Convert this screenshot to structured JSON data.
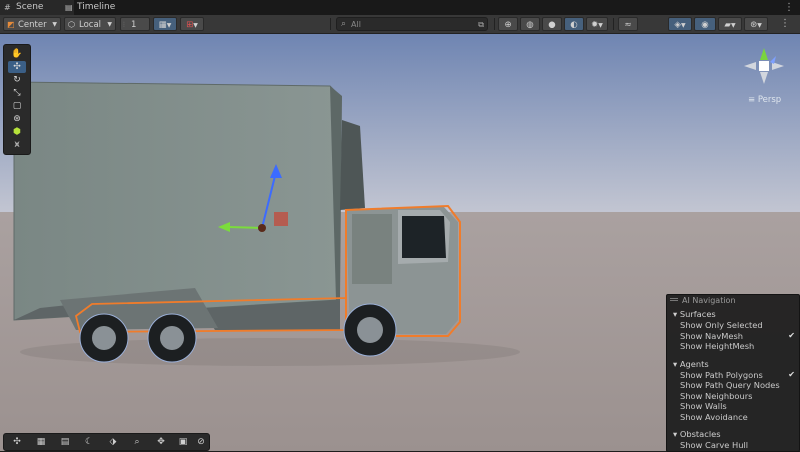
{
  "tabs": [
    {
      "label": "Scene",
      "icon": "hash-icon",
      "active": true
    },
    {
      "label": "Timeline",
      "icon": "timeline-icon",
      "active": false
    }
  ],
  "toolbar": {
    "pivot_label": "Center",
    "space_label": "Local",
    "snap_value": "1",
    "search_placeholder": "All",
    "accent_color": "#46607c"
  },
  "scene_view": {
    "projection_label": "Persp",
    "sky_top": "#7a8fb8",
    "ground_color": "#a59b98"
  },
  "ai_navigation": {
    "title": "AI Navigation",
    "sections": [
      {
        "label": "Surfaces",
        "items": [
          {
            "label": "Show Only Selected",
            "checked": false
          },
          {
            "label": "Show NavMesh",
            "checked": true
          },
          {
            "label": "Show HeightMesh",
            "checked": false
          }
        ]
      },
      {
        "label": "Agents",
        "items": [
          {
            "label": "Show Path Polygons",
            "checked": true
          },
          {
            "label": "Show Path Query Nodes",
            "checked": false
          },
          {
            "label": "Show Neighbours",
            "checked": false
          },
          {
            "label": "Show Walls",
            "checked": false
          },
          {
            "label": "Show Avoidance",
            "checked": false
          }
        ]
      },
      {
        "label": "Obstacles",
        "items": [
          {
            "label": "Show Carve Hull",
            "checked": false
          }
        ]
      }
    ]
  }
}
